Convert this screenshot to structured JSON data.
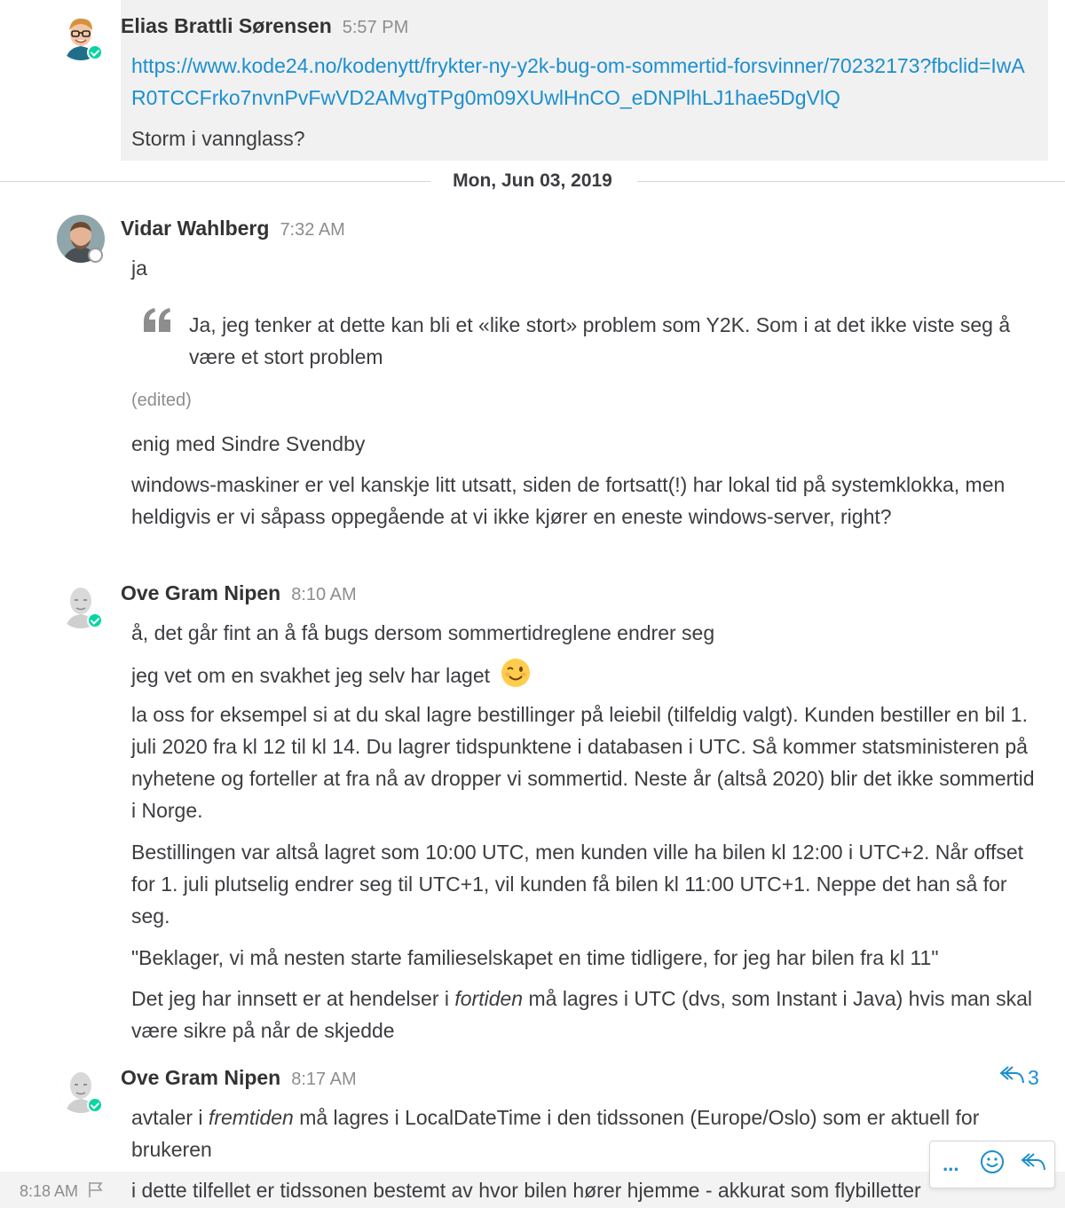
{
  "posts": {
    "elias": {
      "author": "Elias Brattli Sørensen",
      "time": "5:57 PM",
      "link": "https://www.kode24.no/kodenytt/frykter-ny-y2k-bug-om-sommertid-forsvinner/70232173?fbclid=IwAR0TCCFrko7nvnPvFwVD2AMvgTPg0m09XUwlHnCO_eDNPlhLJ1hae5DgVlQ",
      "text": "Storm i vannglass?",
      "status": "online"
    },
    "date_separator": "Mon, Jun 03, 2019",
    "vidar": {
      "author": "Vidar Wahlberg",
      "time": "7:32 AM",
      "status": "offline",
      "msg1": "ja",
      "quote": "Ja, jeg tenker at dette kan bli et «like stort» problem som Y2K. Som i at det ikke viste seg å være et stort problem",
      "edited": "(edited)",
      "msg2": "enig med Sindre Svendby",
      "msg3": "windows-maskiner er vel kanskje litt utsatt, siden de fortsatt(!) har lokal tid på systemklokka, men heldigvis er vi såpass oppegående at vi ikke kjører en eneste windows-server, right?"
    },
    "ove1": {
      "author": "Ove Gram Nipen",
      "time": "8:10 AM",
      "status": "online",
      "msg1": "å, det går fint an å få bugs dersom sommertidreglene endrer seg",
      "msg2": "jeg vet om en svakhet jeg selv har laget",
      "msg3": "la oss for eksempel si at du skal lagre bestillinger på leiebil (tilfeldig valgt). Kunden bestiller en bil 1. juli 2020 fra kl 12 til kl 14. Du lagrer tidspunktene i databasen i UTC. Så kommer statsministeren på nyhetene og forteller at fra nå av dropper vi sommertid. Neste år (altså 2020) blir det ikke sommertid i Norge.",
      "msg4": "Bestillingen var altså lagret som 10:00 UTC, men kunden ville ha bilen kl 12:00 i UTC+2. Når offset for 1. juli plutselig endrer seg til UTC+1, vil kunden få bilen kl 11:00 UTC+1. Neppe det han så for seg.",
      "msg5": "\"Beklager, vi må nesten starte familieselskapet en time tidligere, for jeg har bilen fra kl 11\"",
      "msg6_a": "Det jeg har innsett er at hendelser i ",
      "msg6_em": "fortiden",
      "msg6_b": " må lagres i UTC (dvs, som Instant i Java) hvis man skal være sikre på når de skjedde"
    },
    "ove2": {
      "author": "Ove Gram Nipen",
      "time": "8:17 AM",
      "status": "online",
      "reply_count": "3",
      "msg1_a": "avtaler i ",
      "msg1_em": "fremtiden",
      "msg1_b": " må lagres i LocalDateTime i den tidssonen (Europe/Oslo) som er aktuell for brukeren",
      "hover_time": "8:18 AM",
      "msg2": "i dette tilfellet er tidssonen bestemt av hvor bilen hører hjemme - akkurat som flybilletter"
    }
  },
  "toolbar": {
    "more": "...",
    "icons": [
      "emoji-icon",
      "reply-icon"
    ]
  },
  "colors": {
    "link": "#1c8fce",
    "online": "#06d6a0",
    "highlight": "#f1f1f1"
  }
}
